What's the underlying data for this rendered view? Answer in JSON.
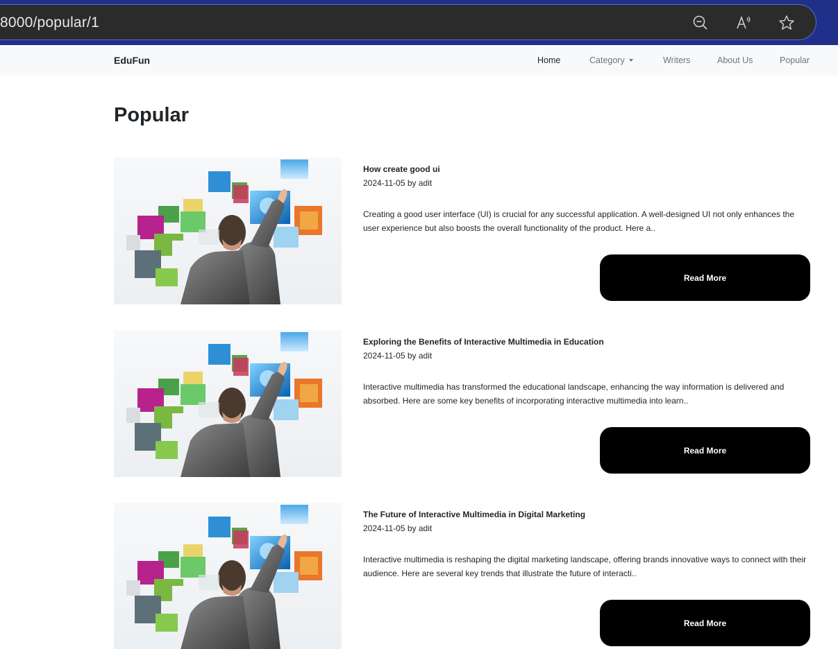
{
  "browser": {
    "url": "8000/popular/1",
    "icons": [
      "zoom-out-icon",
      "read-aloud-icon",
      "favorite-star-icon"
    ]
  },
  "navbar": {
    "brand": "EduFun",
    "links": [
      {
        "label": "Home",
        "active": true
      },
      {
        "label": "Category",
        "dropdown": true
      },
      {
        "label": "Writers"
      },
      {
        "label": "About Us"
      },
      {
        "label": "Popular"
      }
    ]
  },
  "page": {
    "title": "Popular"
  },
  "articles": [
    {
      "title": "How create good ui",
      "date": "2024-11-05",
      "by": "by",
      "author": "adit",
      "excerpt": "Creating a good user interface (UI) is crucial for any successful application. A well-designed UI not only enhances the user experience but also boosts the overall functionality of the product. Here a..",
      "button": "Read More"
    },
    {
      "title": "Exploring the Benefits of Interactive Multimedia in Education",
      "date": "2024-11-05",
      "by": "by",
      "author": "adit",
      "excerpt": "Interactive multimedia has transformed the educational landscape, enhancing the way information is delivered and absorbed. Here are some key benefits of incorporating interactive multimedia into learn..",
      "button": "Read More"
    },
    {
      "title": "The Future of Interactive Multimedia in Digital Marketing",
      "date": "2024-11-05",
      "by": "by",
      "author": "adit",
      "excerpt": "Interactive multimedia is reshaping the digital marketing landscape, offering brands innovative ways to connect with their audience. Here are several key trends that illustrate the future of interacti..",
      "button": "Read More"
    }
  ],
  "colors": {
    "browser_frame": "#1f2f8a",
    "address_bar": "#2b2b2b",
    "navbar_bg": "#f8f9fa",
    "button_bg": "#000000",
    "button_text": "#ffffff"
  }
}
